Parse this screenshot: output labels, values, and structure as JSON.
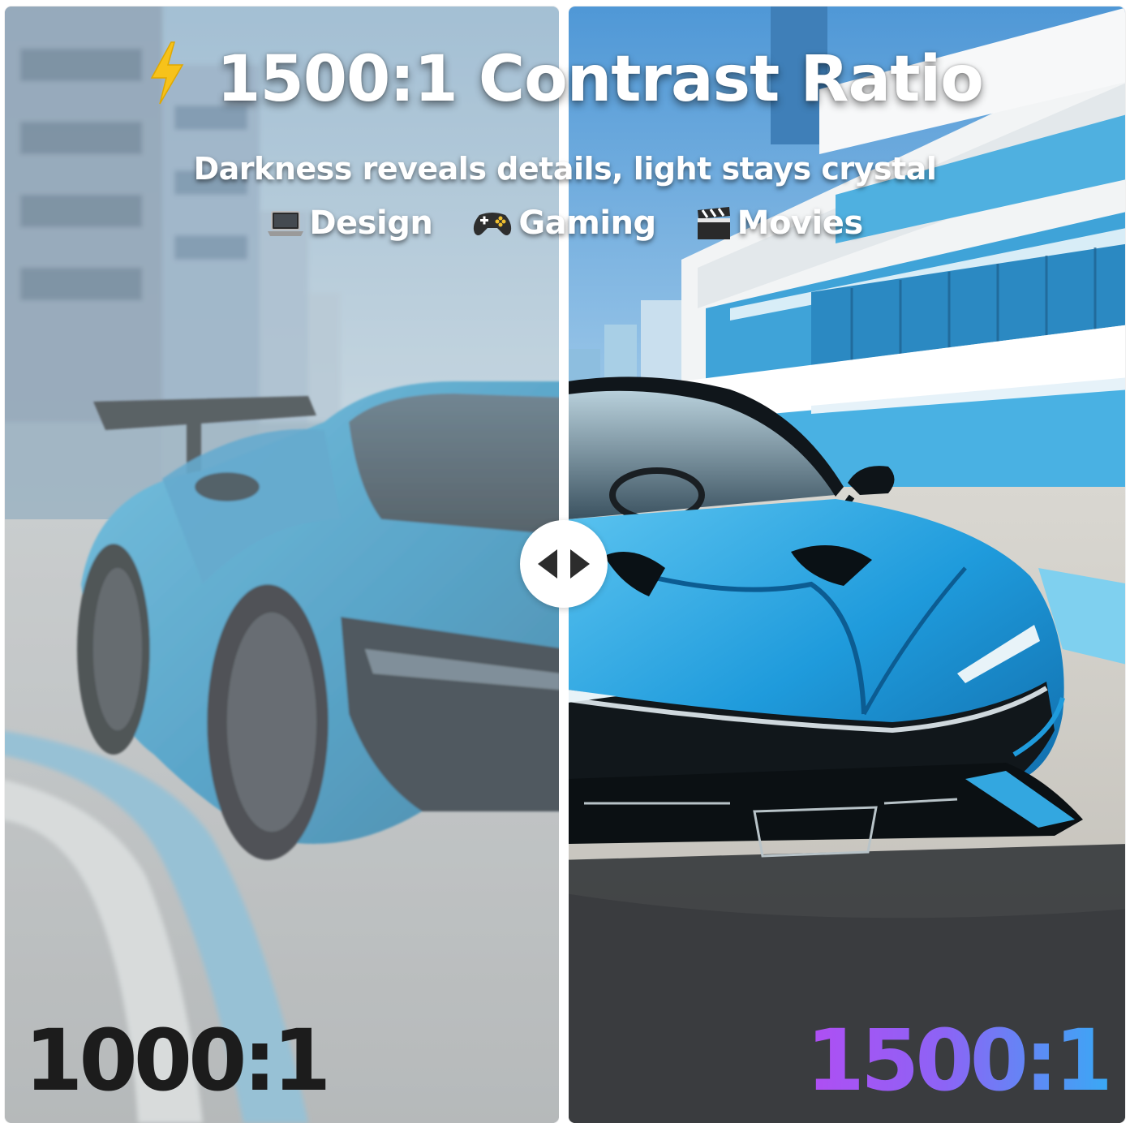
{
  "headline": {
    "icon": "lightning-bolt-icon",
    "text": "1500:1 Contrast Ratio"
  },
  "subheadline": "Darkness reveals details, light stays crystal",
  "tags": [
    {
      "icon": "laptop-icon",
      "label": "Design"
    },
    {
      "icon": "gamepad-icon",
      "label": "Gaming"
    },
    {
      "icon": "clapperboard-icon",
      "label": "Movies"
    }
  ],
  "comparison": {
    "left_label": "1000:1",
    "right_label": "1500:1",
    "handle_icon": "left-right-arrows-icon"
  },
  "colors": {
    "left_label": "#1c1c1c",
    "right_label_gradient": [
      "#b04ef3",
      "#39a9f5"
    ],
    "car_body": "#2aa7de",
    "bolt": "#f7c21a"
  }
}
